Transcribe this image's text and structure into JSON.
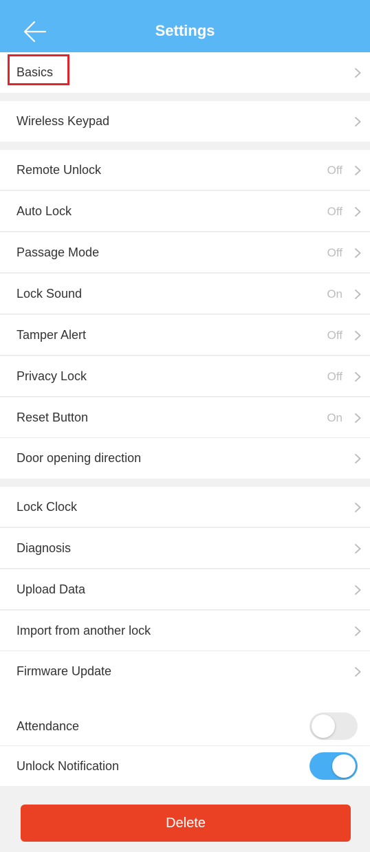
{
  "header": {
    "title": "Settings",
    "back_icon": "arrow-left-icon"
  },
  "colors": {
    "header": "#5ab7f5",
    "toggle_on": "#48aef3",
    "delete": "#ea4124",
    "highlight": "#e0232d"
  },
  "rows": {
    "basics": {
      "label": "Basics"
    },
    "wireless_keypad": {
      "label": "Wireless Keypad"
    },
    "remote_unlock": {
      "label": "Remote Unlock",
      "value": "Off"
    },
    "auto_lock": {
      "label": "Auto Lock",
      "value": "Off"
    },
    "passage_mode": {
      "label": "Passage Mode",
      "value": "Off"
    },
    "lock_sound": {
      "label": "Lock Sound",
      "value": "On"
    },
    "tamper_alert": {
      "label": "Tamper Alert",
      "value": "Off"
    },
    "privacy_lock": {
      "label": "Privacy Lock",
      "value": "Off"
    },
    "reset_button": {
      "label": "Reset Button",
      "value": "On"
    },
    "door_opening_direction": {
      "label": "Door opening direction"
    },
    "lock_clock": {
      "label": "Lock Clock"
    },
    "diagnosis": {
      "label": "Diagnosis"
    },
    "upload_data": {
      "label": "Upload Data"
    },
    "import_from_another_lock": {
      "label": "Import from another lock"
    },
    "firmware_update": {
      "label": "Firmware Update"
    }
  },
  "toggles": {
    "attendance": {
      "label": "Attendance",
      "state": "off"
    },
    "unlock_notification": {
      "label": "Unlock Notification",
      "state": "on"
    }
  },
  "delete_button": {
    "label": "Delete"
  }
}
